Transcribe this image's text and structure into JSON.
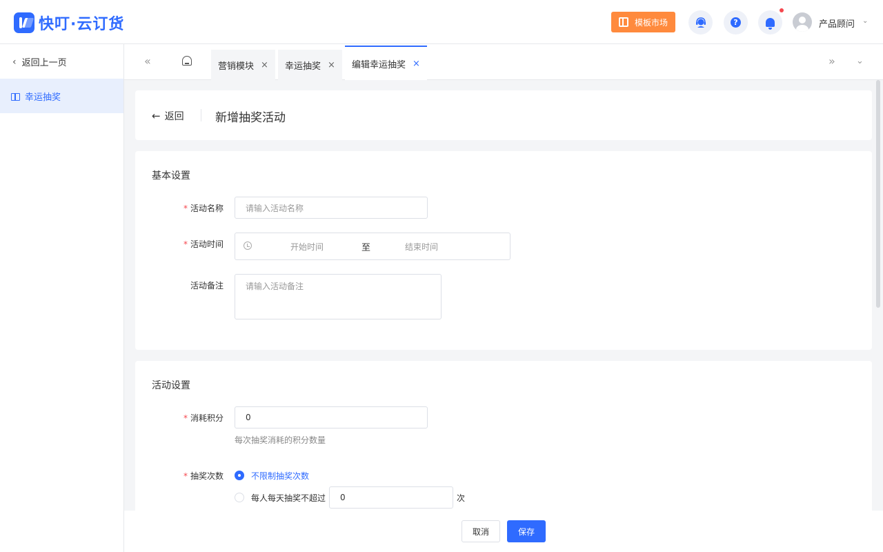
{
  "brand": {
    "name": "快叮·云订货"
  },
  "header": {
    "market_label": "模板市场",
    "help_glyph": "?",
    "user_name": "产品顾问",
    "icons": [
      "layout-icon",
      "service-icon",
      "help-icon",
      "bell-icon",
      "avatar-icon",
      "chevron-down-icon"
    ]
  },
  "sidebar": {
    "back_label": "返回上一页",
    "items": [
      {
        "label": "幸运抽奖",
        "active": true
      }
    ]
  },
  "tabs": [
    {
      "label": "营销模块"
    },
    {
      "label": "幸运抽奖"
    },
    {
      "label": "编辑幸运抽奖",
      "active": true
    }
  ],
  "page": {
    "back_label": "返回",
    "title": "新增抽奖活动"
  },
  "basic": {
    "title": "基本设置",
    "name_label": "活动名称",
    "name_placeholder": "请输入活动名称",
    "time_label": "活动时间",
    "start_placeholder": "开始时间",
    "range_sep": "至",
    "end_placeholder": "结束时间",
    "note_label": "活动备注",
    "note_placeholder": "请输入活动备注"
  },
  "activity": {
    "title": "活动设置",
    "points_label": "消耗积分",
    "points_value": "0",
    "points_hint": "每次抽奖消耗的积分数量",
    "times_label": "抽奖次数",
    "option_unlimited": "不限制抽奖次数",
    "option_limited": "每人每天抽奖不超过",
    "limit_value": "0",
    "limit_unit": "次"
  },
  "footer": {
    "cancel_label": "取消",
    "save_label": "保存"
  },
  "colors": {
    "primary": "#2f6bff",
    "accent": "#ff8a3d",
    "required": "#f5484f"
  }
}
